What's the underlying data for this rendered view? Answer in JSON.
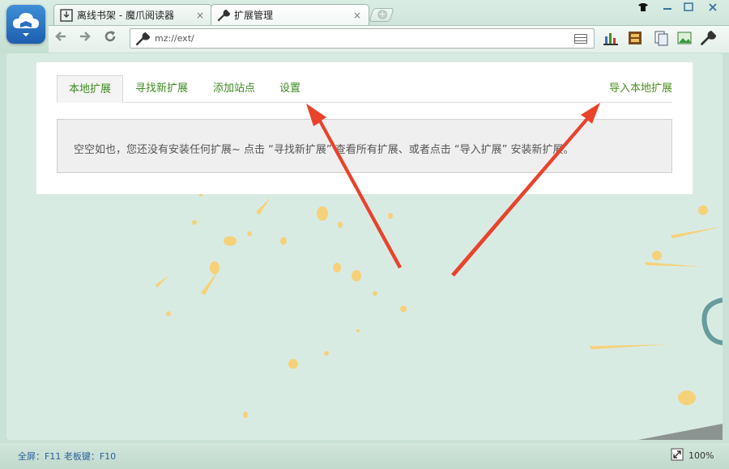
{
  "browser": {
    "tabs": [
      {
        "title": "离线书架 - 魔爪阅读器",
        "icon": "download-box-icon"
      },
      {
        "title": "扩展管理",
        "icon": "wrench-icon"
      }
    ],
    "close_glyph": "×",
    "address": "mz://ext/",
    "status_hint": "全屏：F11 老板键：F10",
    "zoom": "100%"
  },
  "ext_page": {
    "tabs": [
      "本地扩展",
      "寻找新扩展",
      "添加站点",
      "设置"
    ],
    "active_tab": "本地扩展",
    "import_link": "导入本地扩展",
    "empty_message": "空空如也，您还没有安装任何扩展~ 点击 “寻找新扩展” 查看所有扩展、或者点击 “导入扩展” 安装新扩展。"
  },
  "colors": {
    "accent_green": "#3d8a1f",
    "annotation_arrow": "#e8432b",
    "background": "#d8ebe3"
  }
}
